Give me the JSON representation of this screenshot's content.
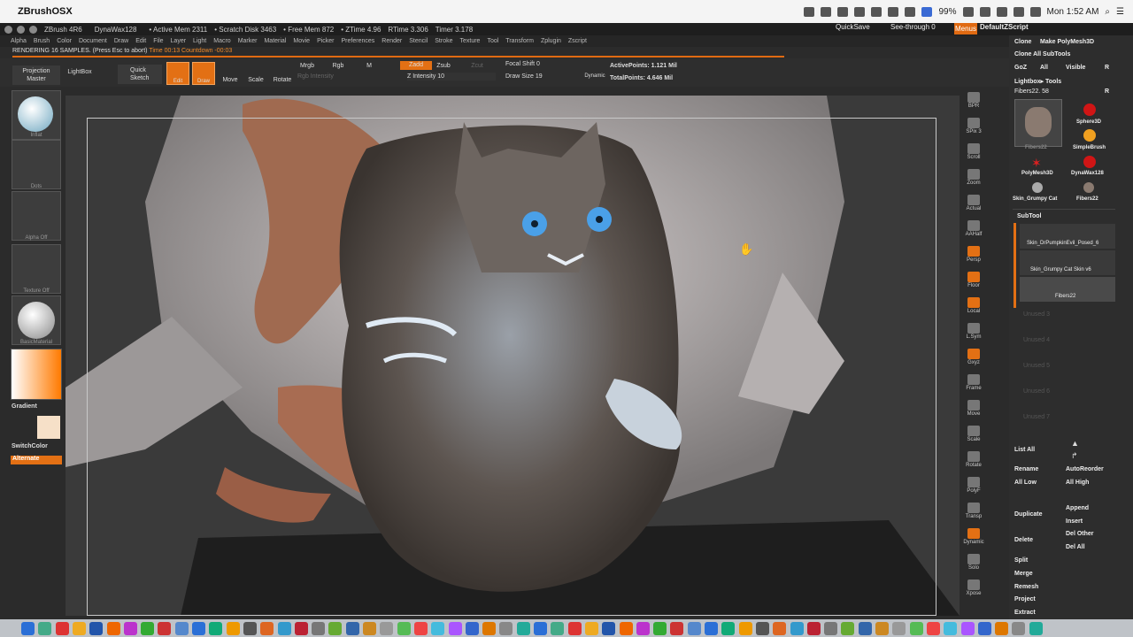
{
  "mac_menubar": {
    "app_name": "ZBrushOSX",
    "battery": "99%",
    "clock": "Mon 1:52 AM"
  },
  "zbrush_title": {
    "version": "ZBrush 4R6",
    "project": "DynaWax128",
    "active_mem": "• Active Mem 2311",
    "scratch_disk": "• Scratch Disk 3463",
    "free_mem": "• Free Mem 872",
    "ztime": "• ZTime 4.96",
    "rtime": "RTime 3.306",
    "timer": "Timer 3.178",
    "quicksave": "QuickSave",
    "see_through": "See-through",
    "see_through_value": "0",
    "menus": "Menus",
    "default_script": "DefaultZScript"
  },
  "zbrush_menus": [
    "Alpha",
    "Brush",
    "Color",
    "Document",
    "Draw",
    "Edit",
    "File",
    "Layer",
    "Light",
    "Macro",
    "Marker",
    "Material",
    "Movie",
    "Picker",
    "Preferences",
    "Render",
    "Stencil",
    "Stroke",
    "Texture",
    "Tool",
    "Transform",
    "Zplugin",
    "Zscript"
  ],
  "status": {
    "rendering": "RENDERING 16 SAMPLES. (Press Esc to abort)",
    "time": "Time 00:13",
    "countdown": "Countdown -00:03"
  },
  "toolbar": {
    "projection_master": "Projection Master",
    "lightbox": "LightBox",
    "quick_sketch": "Quick Sketch",
    "edit": "Edit",
    "draw": "Draw",
    "move": "Move",
    "scale": "Scale",
    "rotate": "Rotate",
    "mrgb": "Mrgb",
    "rgb": "Rgb",
    "m": "M",
    "rgb_intensity": "Rgb Intensity",
    "zadd": "Zadd",
    "zsub": "Zsub",
    "zcut": "Zcut",
    "z_intensity": "Z Intensity 10",
    "focal_shift": "Focal Shift 0",
    "draw_size": "Draw Size 19",
    "dynamic": "Dynamic",
    "active_points": "ActivePoints: 1.121 Mil",
    "total_points": "TotalPoints: 4.646 Mil"
  },
  "left_shelf": {
    "brush": "Inflat",
    "stroke": "Dots",
    "alpha": "Alpha Off",
    "texture": "Texture Off",
    "material": "BasicMaterial",
    "gradient": "Gradient",
    "switch_color": "SwitchColor",
    "alternate": "Alternate"
  },
  "right_shelf": [
    "BPR",
    "SPix 3",
    "Scroll",
    "Zoom",
    "Actual",
    "AAHalf",
    "Persp",
    "Floor",
    "Local",
    "L.Sym",
    "Gxyz",
    "Frame",
    "Move",
    "Scale",
    "Rotate",
    "PolyF",
    "Transp",
    "Dynamic",
    "Solo",
    "Xpose"
  ],
  "tool_palette": {
    "clone": "Clone",
    "make_polymesh": "Make PolyMesh3D",
    "clone_all": "Clone All SubTools",
    "goz": "GoZ",
    "all": "All",
    "visible": "Visible",
    "r": "R",
    "lightbox_tools": "Lightbox▸ Tools",
    "current_tool": "Fibers22. 58",
    "tools": [
      "Fibers22",
      "Sphere3D",
      "SimpleBrush",
      "PolyMesh3D",
      "DynaWax128",
      "Skin_Grumpy Cat",
      "Fibers22"
    ],
    "subtool_header": "SubTool",
    "subtools": [
      "Skin_DrPumpkinEvil_Posed_6",
      "Skin_Grumpy Cat Skin v6",
      "Fibers22"
    ],
    "unused": [
      "Unused 3",
      "Unused 4",
      "Unused 5",
      "Unused 6",
      "Unused 7"
    ],
    "list_all": "List All",
    "rename": "Rename",
    "auto_reorder": "AutoReorder",
    "all_low": "All Low",
    "all_high": "All High",
    "duplicate": "Duplicate",
    "append": "Append",
    "insert": "Insert",
    "delete": "Delete",
    "del_other": "Del Other",
    "del_all": "Del All",
    "split": "Split",
    "merge": "Merge",
    "remesh": "Remesh",
    "project": "Project",
    "extract": "Extract"
  },
  "colors": {
    "accent": "#e37014",
    "panel": "#2d2d2d",
    "viewport": "#3a3a3a"
  }
}
